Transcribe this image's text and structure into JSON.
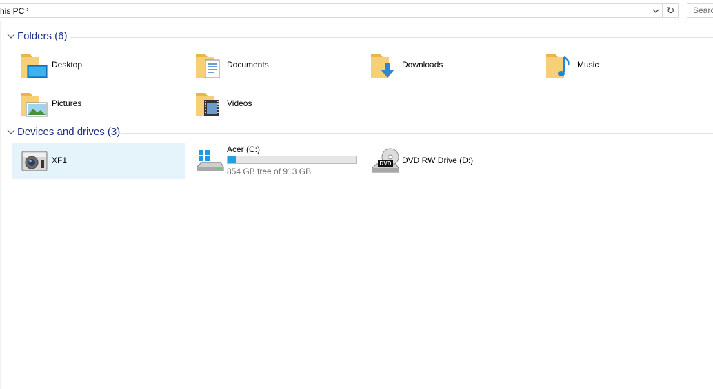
{
  "address_bar": {
    "path": "his PC",
    "separator": "›"
  },
  "refresh_glyph": "↻",
  "search": {
    "placeholder": "Searc"
  },
  "groups": {
    "folders": {
      "title": "Folders (6)"
    },
    "devices": {
      "title": "Devices and drives (3)"
    }
  },
  "folders": [
    {
      "label": "Desktop",
      "icon": "desktop-folder-icon"
    },
    {
      "label": "Documents",
      "icon": "documents-folder-icon"
    },
    {
      "label": "Downloads",
      "icon": "downloads-folder-icon"
    },
    {
      "label": "Music",
      "icon": "music-folder-icon"
    },
    {
      "label": "Pictures",
      "icon": "pictures-folder-icon"
    },
    {
      "label": "Videos",
      "icon": "videos-folder-icon"
    }
  ],
  "devices": [
    {
      "label": "XF1",
      "icon": "camera-icon",
      "selected": true
    },
    {
      "label": "Acer (C:)",
      "icon": "windows-drive-icon",
      "free_text": "854 GB free of 913 GB",
      "used_fraction": 0.065
    },
    {
      "label": "DVD RW Drive (D:)",
      "icon": "dvd-drive-icon"
    }
  ],
  "colors": {
    "header_text": "#1e3287",
    "selection": "#e5f3fb",
    "drive_fill": "#26a0da",
    "folder_yellow": "#f5d077"
  }
}
